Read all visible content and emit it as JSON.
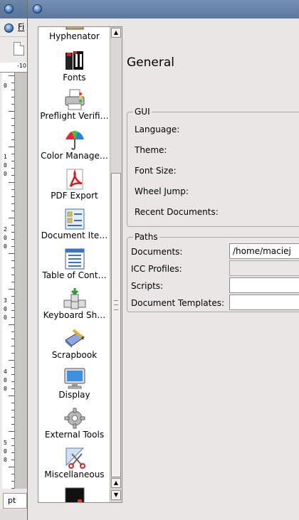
{
  "background_window": {
    "menu_file_label": "Fi",
    "ruler_top_label": "-10",
    "ruler_left_digits": [
      "0",
      "1",
      "0",
      "0",
      "2",
      "0",
      "0",
      "3",
      "0",
      "0",
      "4",
      "0",
      "0",
      "5",
      "0",
      "0"
    ],
    "unit_label": "pt"
  },
  "dialog": {
    "page_list": {
      "items": [
        {
          "label": "Hyphenator",
          "icon": "hyphenator-icon"
        },
        {
          "label": "Fonts",
          "icon": "fonts-icon"
        },
        {
          "label": "Preflight Verifi…",
          "icon": "printer-preflight-icon"
        },
        {
          "label": "Color Manage…",
          "icon": "umbrella-color-icon"
        },
        {
          "label": "PDF Export",
          "icon": "pdf-icon"
        },
        {
          "label": "Document Ite…",
          "icon": "document-items-icon"
        },
        {
          "label": "Table of Cont…",
          "icon": "table-of-contents-icon"
        },
        {
          "label": "Keyboard Sh…",
          "icon": "keyboard-shortcuts-icon"
        },
        {
          "label": "Scrapbook",
          "icon": "scrapbook-icon"
        },
        {
          "label": "Display",
          "icon": "monitor-icon"
        },
        {
          "label": "External Tools",
          "icon": "gear-icon"
        },
        {
          "label": "Miscellaneous",
          "icon": "scissors-icon"
        }
      ]
    },
    "page_title": "General",
    "gui": {
      "title": "GUI",
      "language": "Language:",
      "theme": "Theme:",
      "font_size": "Font Size:",
      "wheel_jump": "Wheel Jump:",
      "recent_documents": "Recent Documents:"
    },
    "paths": {
      "title": "Paths",
      "documents_label": "Documents:",
      "documents_value": "/home/maciej",
      "icc_label": "ICC Profiles:",
      "icc_value": "",
      "scripts_label": "Scripts:",
      "scripts_value": "",
      "templates_label": "Document Templates:",
      "templates_value": ""
    }
  }
}
